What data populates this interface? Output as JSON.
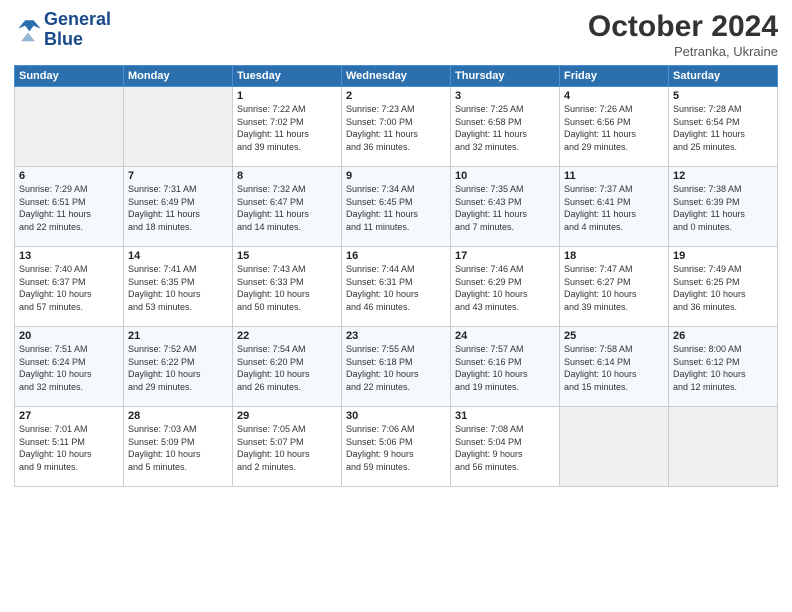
{
  "logo": {
    "line1": "General",
    "line2": "Blue"
  },
  "title": "October 2024",
  "subtitle": "Petranka, Ukraine",
  "days_header": [
    "Sunday",
    "Monday",
    "Tuesday",
    "Wednesday",
    "Thursday",
    "Friday",
    "Saturday"
  ],
  "weeks": [
    [
      {
        "day": "",
        "info": ""
      },
      {
        "day": "",
        "info": ""
      },
      {
        "day": "1",
        "info": "Sunrise: 7:22 AM\nSunset: 7:02 PM\nDaylight: 11 hours\nand 39 minutes."
      },
      {
        "day": "2",
        "info": "Sunrise: 7:23 AM\nSunset: 7:00 PM\nDaylight: 11 hours\nand 36 minutes."
      },
      {
        "day": "3",
        "info": "Sunrise: 7:25 AM\nSunset: 6:58 PM\nDaylight: 11 hours\nand 32 minutes."
      },
      {
        "day": "4",
        "info": "Sunrise: 7:26 AM\nSunset: 6:56 PM\nDaylight: 11 hours\nand 29 minutes."
      },
      {
        "day": "5",
        "info": "Sunrise: 7:28 AM\nSunset: 6:54 PM\nDaylight: 11 hours\nand 25 minutes."
      }
    ],
    [
      {
        "day": "6",
        "info": "Sunrise: 7:29 AM\nSunset: 6:51 PM\nDaylight: 11 hours\nand 22 minutes."
      },
      {
        "day": "7",
        "info": "Sunrise: 7:31 AM\nSunset: 6:49 PM\nDaylight: 11 hours\nand 18 minutes."
      },
      {
        "day": "8",
        "info": "Sunrise: 7:32 AM\nSunset: 6:47 PM\nDaylight: 11 hours\nand 14 minutes."
      },
      {
        "day": "9",
        "info": "Sunrise: 7:34 AM\nSunset: 6:45 PM\nDaylight: 11 hours\nand 11 minutes."
      },
      {
        "day": "10",
        "info": "Sunrise: 7:35 AM\nSunset: 6:43 PM\nDaylight: 11 hours\nand 7 minutes."
      },
      {
        "day": "11",
        "info": "Sunrise: 7:37 AM\nSunset: 6:41 PM\nDaylight: 11 hours\nand 4 minutes."
      },
      {
        "day": "12",
        "info": "Sunrise: 7:38 AM\nSunset: 6:39 PM\nDaylight: 11 hours\nand 0 minutes."
      }
    ],
    [
      {
        "day": "13",
        "info": "Sunrise: 7:40 AM\nSunset: 6:37 PM\nDaylight: 10 hours\nand 57 minutes."
      },
      {
        "day": "14",
        "info": "Sunrise: 7:41 AM\nSunset: 6:35 PM\nDaylight: 10 hours\nand 53 minutes."
      },
      {
        "day": "15",
        "info": "Sunrise: 7:43 AM\nSunset: 6:33 PM\nDaylight: 10 hours\nand 50 minutes."
      },
      {
        "day": "16",
        "info": "Sunrise: 7:44 AM\nSunset: 6:31 PM\nDaylight: 10 hours\nand 46 minutes."
      },
      {
        "day": "17",
        "info": "Sunrise: 7:46 AM\nSunset: 6:29 PM\nDaylight: 10 hours\nand 43 minutes."
      },
      {
        "day": "18",
        "info": "Sunrise: 7:47 AM\nSunset: 6:27 PM\nDaylight: 10 hours\nand 39 minutes."
      },
      {
        "day": "19",
        "info": "Sunrise: 7:49 AM\nSunset: 6:25 PM\nDaylight: 10 hours\nand 36 minutes."
      }
    ],
    [
      {
        "day": "20",
        "info": "Sunrise: 7:51 AM\nSunset: 6:24 PM\nDaylight: 10 hours\nand 32 minutes."
      },
      {
        "day": "21",
        "info": "Sunrise: 7:52 AM\nSunset: 6:22 PM\nDaylight: 10 hours\nand 29 minutes."
      },
      {
        "day": "22",
        "info": "Sunrise: 7:54 AM\nSunset: 6:20 PM\nDaylight: 10 hours\nand 26 minutes."
      },
      {
        "day": "23",
        "info": "Sunrise: 7:55 AM\nSunset: 6:18 PM\nDaylight: 10 hours\nand 22 minutes."
      },
      {
        "day": "24",
        "info": "Sunrise: 7:57 AM\nSunset: 6:16 PM\nDaylight: 10 hours\nand 19 minutes."
      },
      {
        "day": "25",
        "info": "Sunrise: 7:58 AM\nSunset: 6:14 PM\nDaylight: 10 hours\nand 15 minutes."
      },
      {
        "day": "26",
        "info": "Sunrise: 8:00 AM\nSunset: 6:12 PM\nDaylight: 10 hours\nand 12 minutes."
      }
    ],
    [
      {
        "day": "27",
        "info": "Sunrise: 7:01 AM\nSunset: 5:11 PM\nDaylight: 10 hours\nand 9 minutes."
      },
      {
        "day": "28",
        "info": "Sunrise: 7:03 AM\nSunset: 5:09 PM\nDaylight: 10 hours\nand 5 minutes."
      },
      {
        "day": "29",
        "info": "Sunrise: 7:05 AM\nSunset: 5:07 PM\nDaylight: 10 hours\nand 2 minutes."
      },
      {
        "day": "30",
        "info": "Sunrise: 7:06 AM\nSunset: 5:06 PM\nDaylight: 9 hours\nand 59 minutes."
      },
      {
        "day": "31",
        "info": "Sunrise: 7:08 AM\nSunset: 5:04 PM\nDaylight: 9 hours\nand 56 minutes."
      },
      {
        "day": "",
        "info": ""
      },
      {
        "day": "",
        "info": ""
      }
    ]
  ]
}
